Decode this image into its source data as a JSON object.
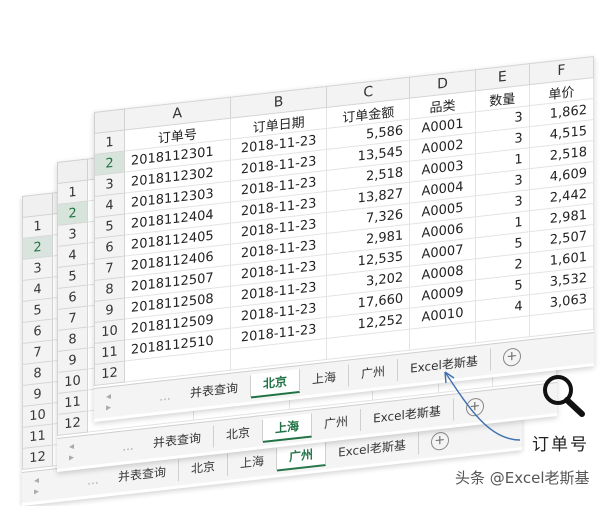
{
  "columns": [
    "A",
    "B",
    "C",
    "D",
    "E",
    "F"
  ],
  "headers": [
    "订单号",
    "订单日期",
    "订单金额",
    "品类",
    "数量",
    "单价"
  ],
  "row_numbers": [
    "1",
    "2",
    "3",
    "4",
    "5",
    "6",
    "7",
    "8",
    "9",
    "10",
    "11",
    "12"
  ],
  "rows": [
    [
      "2018112301",
      "2018-11-23",
      "5,586",
      "A0001",
      "3",
      "1,862"
    ],
    [
      "2018112302",
      "2018-11-23",
      "13,545",
      "A0002",
      "3",
      "4,515"
    ],
    [
      "2018112303",
      "2018-11-23",
      "2,518",
      "A0003",
      "1",
      "2,518"
    ],
    [
      "2018112404",
      "2018-11-23",
      "13,827",
      "A0004",
      "3",
      "4,609"
    ],
    [
      "2018112405",
      "2018-11-23",
      "7,326",
      "A0005",
      "3",
      "2,442"
    ],
    [
      "2018112406",
      "2018-11-23",
      "2,981",
      "A0006",
      "1",
      "2,981"
    ],
    [
      "2018112507",
      "2018-11-23",
      "12,535",
      "A0007",
      "5",
      "2,507"
    ],
    [
      "2018112508",
      "2018-11-23",
      "3,202",
      "A0008",
      "2",
      "1,601"
    ],
    [
      "2018112509",
      "2018-11-23",
      "17,660",
      "A0009",
      "5",
      "3,532"
    ],
    [
      "2018112510",
      "2018-11-23",
      "12,252",
      "A0010",
      "4",
      "3,063"
    ]
  ],
  "tabs": [
    "并表查询",
    "北京",
    "上海",
    "广州",
    "Excel老斯基"
  ],
  "sheets": [
    {
      "id": "front",
      "active_tab": 1
    },
    {
      "id": "middle",
      "active_tab": 2
    },
    {
      "id": "back",
      "active_tab": 3
    }
  ],
  "nav_arrows": "◂ ▸",
  "nav_more": "...",
  "add_sheet": "+",
  "callout": {
    "label": "订单号"
  },
  "watermark": "头条 @Excel老斯基",
  "colors": {
    "accent": "#217346",
    "selected_header": "#d7e4dc"
  }
}
